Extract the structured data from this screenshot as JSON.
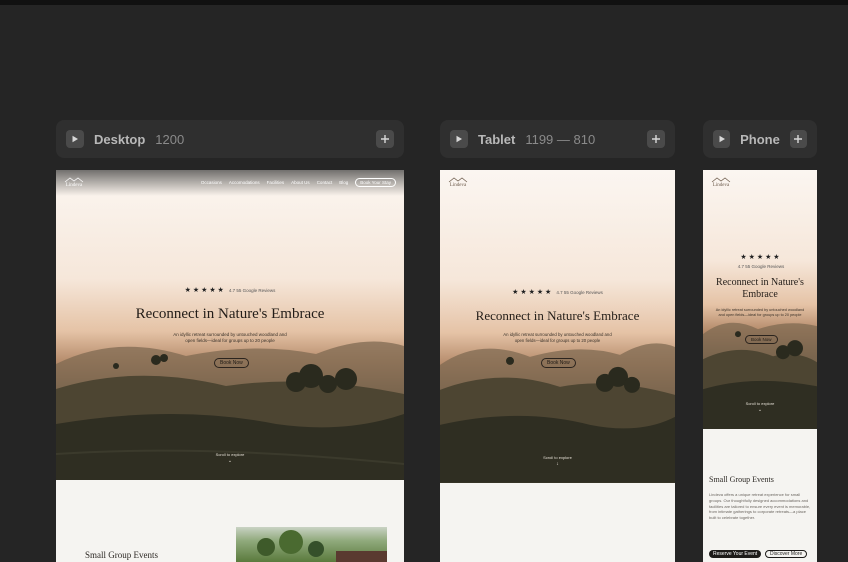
{
  "breakpoints": [
    {
      "name": "Desktop",
      "range": "1200"
    },
    {
      "name": "Tablet",
      "range": "1199 — 810"
    },
    {
      "name": "Phone",
      "range": ""
    }
  ],
  "site": {
    "logo_text": "Lindeva",
    "nav": [
      "Occasions",
      "Accomodations",
      "Facilities",
      "About Us",
      "Contact",
      "Blog"
    ],
    "book_button": "Book Your Stay",
    "stars": "★ ★ ★ ★ ★",
    "reviews": "4.7 55 Google Reviews",
    "headline": "Reconnect in Nature's Embrace",
    "subtext": "An idyllic retreat surrounded by untouched woodland and open fields—ideal for groups up to 20 people",
    "cta": "Book Now",
    "scroll": "Scroll to explore",
    "section_title": "Small Group Events",
    "section_text": "Lindeva offers a unique retreat experience for small groups. Our thoughtfully designed accommodations and facilities are tailored to ensure every event is memorable, from intimate gatherings to corporate retreats—a place built to celebrate together.",
    "btn_reserve": "Reserve Your Event",
    "btn_discover": "Discover More"
  },
  "colors": {
    "canvas": "#252525",
    "header": "#2f2f2f",
    "page_bg": "#f5f4f1"
  },
  "icons": {
    "play": "play-icon",
    "plus": "plus-icon",
    "chevron": "chevron-down-icon"
  }
}
